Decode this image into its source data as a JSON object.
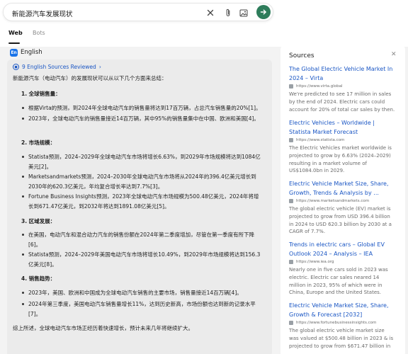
{
  "search": {
    "query": "新能源汽车发展现状",
    "icons": [
      "close-icon",
      "attach-icon",
      "image-icon",
      "submit-arrow-icon"
    ]
  },
  "tabs": [
    {
      "label": "Web",
      "active": true
    },
    {
      "label": "Bots",
      "active": false
    }
  ],
  "language": {
    "badge": "En",
    "label": "English"
  },
  "answer": {
    "sources_link": "9 English Sources Reviewed",
    "intro": "新能源汽车（电动汽车）的发展现状可以从以下几个方面来总结：",
    "sections": [
      {
        "title": "1. 全球销售量：",
        "bullets": [
          "根据Virta的预测，到2024年全球电动汽车的销售量将达到17百万辆，占总汽车销售量的20%[1]。",
          "2023年，全球电动汽车的销售量接近14百万辆，其中95%的销售量集中在中国、欧洲和美国[4]。"
        ]
      },
      {
        "title": "2. 市场规模：",
        "bullets": [
          "Statista预测，2024–2029年全球电动汽车市场将增长6.63%，到2029年市场规模将达到1084亿美元[2]。",
          "Marketsandmarkets预测，2024–2030年全球电动汽车市场将从2024年的396.4亿美元增长到2030年的620.3亿美元，年均复合增长率达到7.7%[3]。",
          "Fortune Business Insights预测，2023年全球电动汽车市场规模为500.48亿美元，2024年将增长到671.47亿美元，到2032年将达到1891.08亿美元[5]。"
        ]
      },
      {
        "title": "3. 区域发展：",
        "bullets": [
          "在美国，电动汽车和混合动力汽车的销售份额在2024年第二季度增加，尽管在第一季度有所下降[6]。",
          "Statista预测，2024–2029年美国电动汽车市场将增长10.49%，到2029年市场规模将达到156.3亿美元[8]。"
        ]
      },
      {
        "title": "4. 销售趋势：",
        "bullets": [
          "2023年，美国、欧洲和中国成为全球电动汽车销售的主要市场，销售量接近14百万辆[4]。",
          "2024年第三季度，美国电动汽车销售量增长11%，达到历史新高，市场份额也达到新的记录水平[7]。"
        ]
      }
    ],
    "conclusion": "综上所述，全球电动汽车市场正经历着快速增长，预计未来几年将继续扩大。"
  },
  "sources_panel": {
    "title": "Sources",
    "close_icon": "close-icon",
    "items": [
      {
        "title": "The Global Electric Vehicle Market In 2024 – Virta",
        "url": "https://www.virta.global",
        "snippet": "We're predicted to see 17 million in sales by the end of 2024. Electric cars could account for 20% of total car sales by then."
      },
      {
        "title": "Electric Vehicles – Worldwide | Statista Market Forecast",
        "url": "https://www.statista.com",
        "snippet": "The Electric Vehicles market worldwide is projected to grow by 6.63% (2024–2029) resulting in a market volume of US$1084.0bn in 2029."
      },
      {
        "title": "Electric Vehicle Market Size, Share, Growth, Trends & Analysis by ...",
        "url": "https://www.marketsandmarkets.com",
        "snippet": "The global electric vehicle (EV) market is projected to grow from USD 396.4 billion in 2024 to USD 620.3 billion by 2030 at a CAGR of 7.7%."
      },
      {
        "title": "Trends in electric cars – Global EV Outlook 2024 – Analysis – IEA",
        "url": "https://www.iea.org",
        "snippet": "Nearly one in five cars sold in 2023 was electric. Electric car sales neared 14 million in 2023, 95% of which were in China, Europe and the United States."
      },
      {
        "title": "Electric Vehicle Market Size, Share, Growth & Forecast [2032]",
        "url": "https://www.fortunebusinessinsights.com",
        "snippet": "The global electric vehicle market size was valued at $500.48 billion in 2023 & is projected to grow from $671.47 billion in"
      }
    ]
  }
}
